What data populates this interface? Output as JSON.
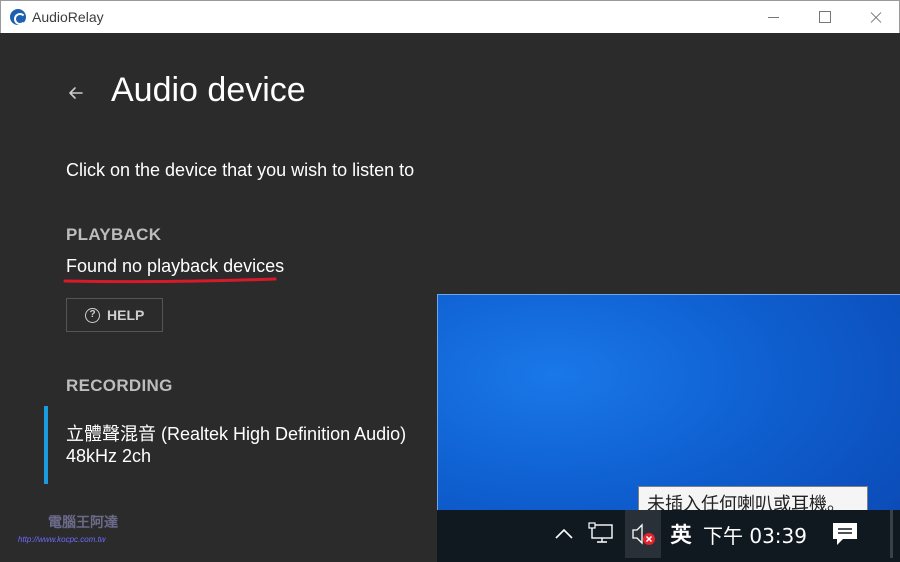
{
  "window": {
    "app_title": "AudioRelay"
  },
  "page": {
    "title": "Audio device",
    "subtitle": "Click on the device that you wish to listen to"
  },
  "playback": {
    "heading": "PLAYBACK",
    "empty_message": "Found no playback devices",
    "help_label": "HELP",
    "underline_color": "#d8192a"
  },
  "recording": {
    "heading": "RECORDING",
    "devices": [
      {
        "name": "立體聲混音 (Realtek High Definition Audio)",
        "format": "48kHz 2ch"
      }
    ],
    "accent_color": "#1b9be0"
  },
  "overlay": {
    "tooltip": "未插入任何喇叭或耳機。",
    "taskbar": {
      "ime_label": "英",
      "clock": "下午 03:39",
      "icons": [
        "chevron-up-icon",
        "network-icon",
        "volume-muted-icon",
        "notification-icon"
      ]
    }
  },
  "watermark": {
    "cloud_text": "電腦王阿達",
    "url": "http://www.kocpc.com.tw"
  }
}
